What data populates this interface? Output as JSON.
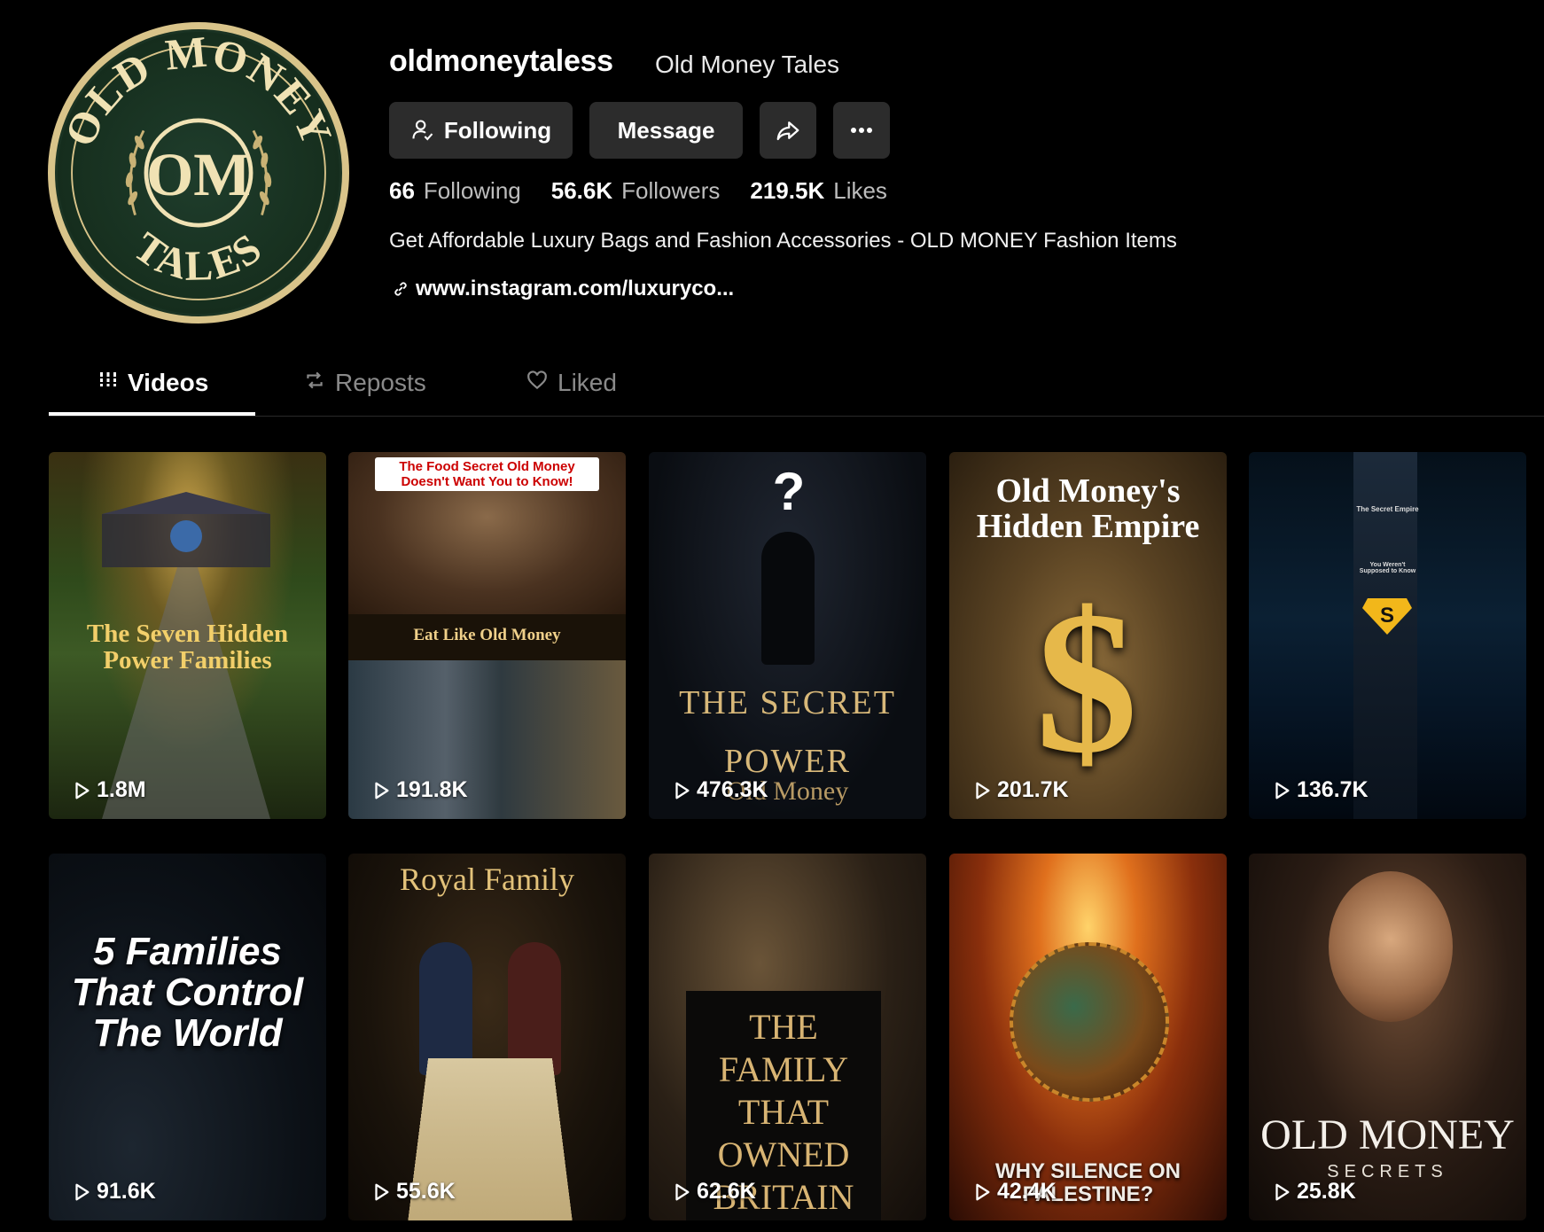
{
  "profile": {
    "username": "oldmoneytaless",
    "display_name": "Old Money Tales",
    "avatar_text_top": "OLD MONEY",
    "avatar_monogram": "OM",
    "avatar_text_bottom": "TALES",
    "buttons": {
      "following": "Following",
      "message": "Message"
    },
    "stats": [
      {
        "value": "66",
        "label": "Following"
      },
      {
        "value": "56.6K",
        "label": "Followers"
      },
      {
        "value": "219.5K",
        "label": "Likes"
      }
    ],
    "bio": "Get Affordable Luxury Bags and Fashion Accessories - OLD MONEY Fashion Items",
    "link": "www.instagram.com/luxuryco..."
  },
  "tabs": [
    {
      "label": "Videos",
      "active": true
    },
    {
      "label": "Reposts",
      "active": false
    },
    {
      "label": "Liked",
      "active": false
    }
  ],
  "videos": [
    {
      "title": "The Seven Hidden Power Families",
      "views": "1.8M"
    },
    {
      "title_top": "The Food Secret Old Money Doesn't Want You to Know!",
      "title": "Eat Like Old Money",
      "views": "191.8K"
    },
    {
      "title": "The Secret Power",
      "subtitle": "Old Money",
      "views": "476.3K"
    },
    {
      "title": "Old Money's Hidden Empire",
      "views": "201.7K"
    },
    {
      "title": "The Secret Empire",
      "subtitle": "You Weren't Supposed to Know",
      "views": "136.7K"
    },
    {
      "title": "5 Families That Control The World",
      "views": "91.6K"
    },
    {
      "title": "Royal Family",
      "views": "55.6K"
    },
    {
      "title": "The Family That Owned Britain",
      "views": "62.6K"
    },
    {
      "title": "Why Silence On Palestine?",
      "views": "42.4K"
    },
    {
      "title": "Old Money",
      "subtitle": "Secrets",
      "views": "25.8K"
    }
  ],
  "colors": {
    "background": "#000000",
    "button_bg": "#2c2c2c",
    "muted_text": "#bdbdbd",
    "gold": "#d9c48a",
    "avatar_green": "#1f3d2c"
  }
}
